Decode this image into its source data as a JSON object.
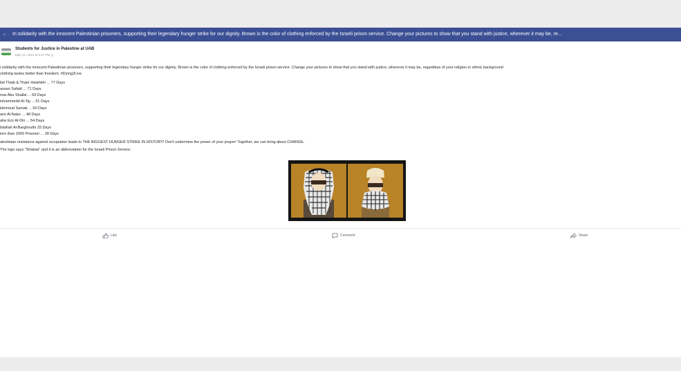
{
  "banner": {
    "text": "In solidarity with the innocent Palestinian prisoners, supporting their legendary hunger strike for our dignity. Brown is the color of clothing enforced by the Israeli prison service. Change your pictures to show that you stand with justice, wherever it may be, re..."
  },
  "post": {
    "page_name": "Students for Justice in Palestine at UAB",
    "timestamp": "May 14, 2012 at 6:47 PM",
    "intro": "i solidarity with the innocent Palestinian prisoners, supporting their legendary hunger strike for our dignity. Brown is the color of clothing enforced by the Israeli prison service. Change your pictures to show that you stand with justice, wherever it may be, regardless of your religion or ethnic background",
    "tagline": "clothing tastes better than freedom. #Dying2Live",
    "prisoners": [
      "ilal Thiab & Thaer Halahleh ... 77 Days",
      "assan Safadi ... 71 Days",
      "mar Abu Shallal ... 69 Days",
      "iohammedd Al-Taj ... 61 Days",
      "lahmoud Sarsak ... 50 Days",
      "aris Al-Natur ... 48 Days",
      "afar Ezz Al-Din ... 54 Days",
      "bdallah Al-Barghouthi 33 Days",
      "iore than 2000 Prisoner ... 28 Days"
    ],
    "resistance": "alestinian resistance against occupation leads to THE BIGGEST HUNGER STRIKE IN HISTORY! Don't undermine the power of your prayer! Together, we can bring about CHANGE.",
    "logo_note": "The logo says \"Shabas\" and it is an abbreviation for the Israeli Prison Service."
  },
  "actions": {
    "like": "Like",
    "comment": "Comment",
    "share": "Share"
  },
  "colors": {
    "banner_bg": "#3b4f94",
    "panel_brown": "#b98328",
    "page_bg": "#ececec"
  }
}
